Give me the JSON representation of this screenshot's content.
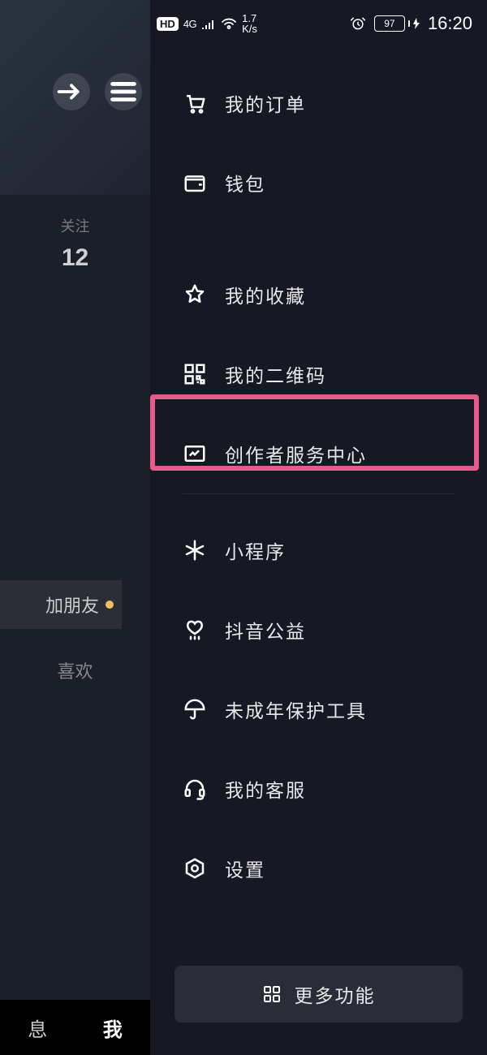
{
  "status_bar": {
    "hd": "HD",
    "signal": "4G",
    "speed_top": "1.7",
    "speed_bot": "K/s",
    "battery": "97",
    "time": "16:20"
  },
  "profile": {
    "follow_label": "关注",
    "follow_count": "12",
    "add_friend": "加朋友",
    "tab_like": "喜欢",
    "nav_msg": "息",
    "nav_me": "我"
  },
  "menu": {
    "orders": "我的订单",
    "wallet": "钱包",
    "favorites": "我的收藏",
    "qrcode": "我的二维码",
    "creator": "创作者服务中心",
    "miniapp": "小程序",
    "charity": "抖音公益",
    "minor": "未成年保护工具",
    "support": "我的客服",
    "settings": "设置",
    "more": "更多功能"
  },
  "highlight": {
    "target": "creator"
  }
}
